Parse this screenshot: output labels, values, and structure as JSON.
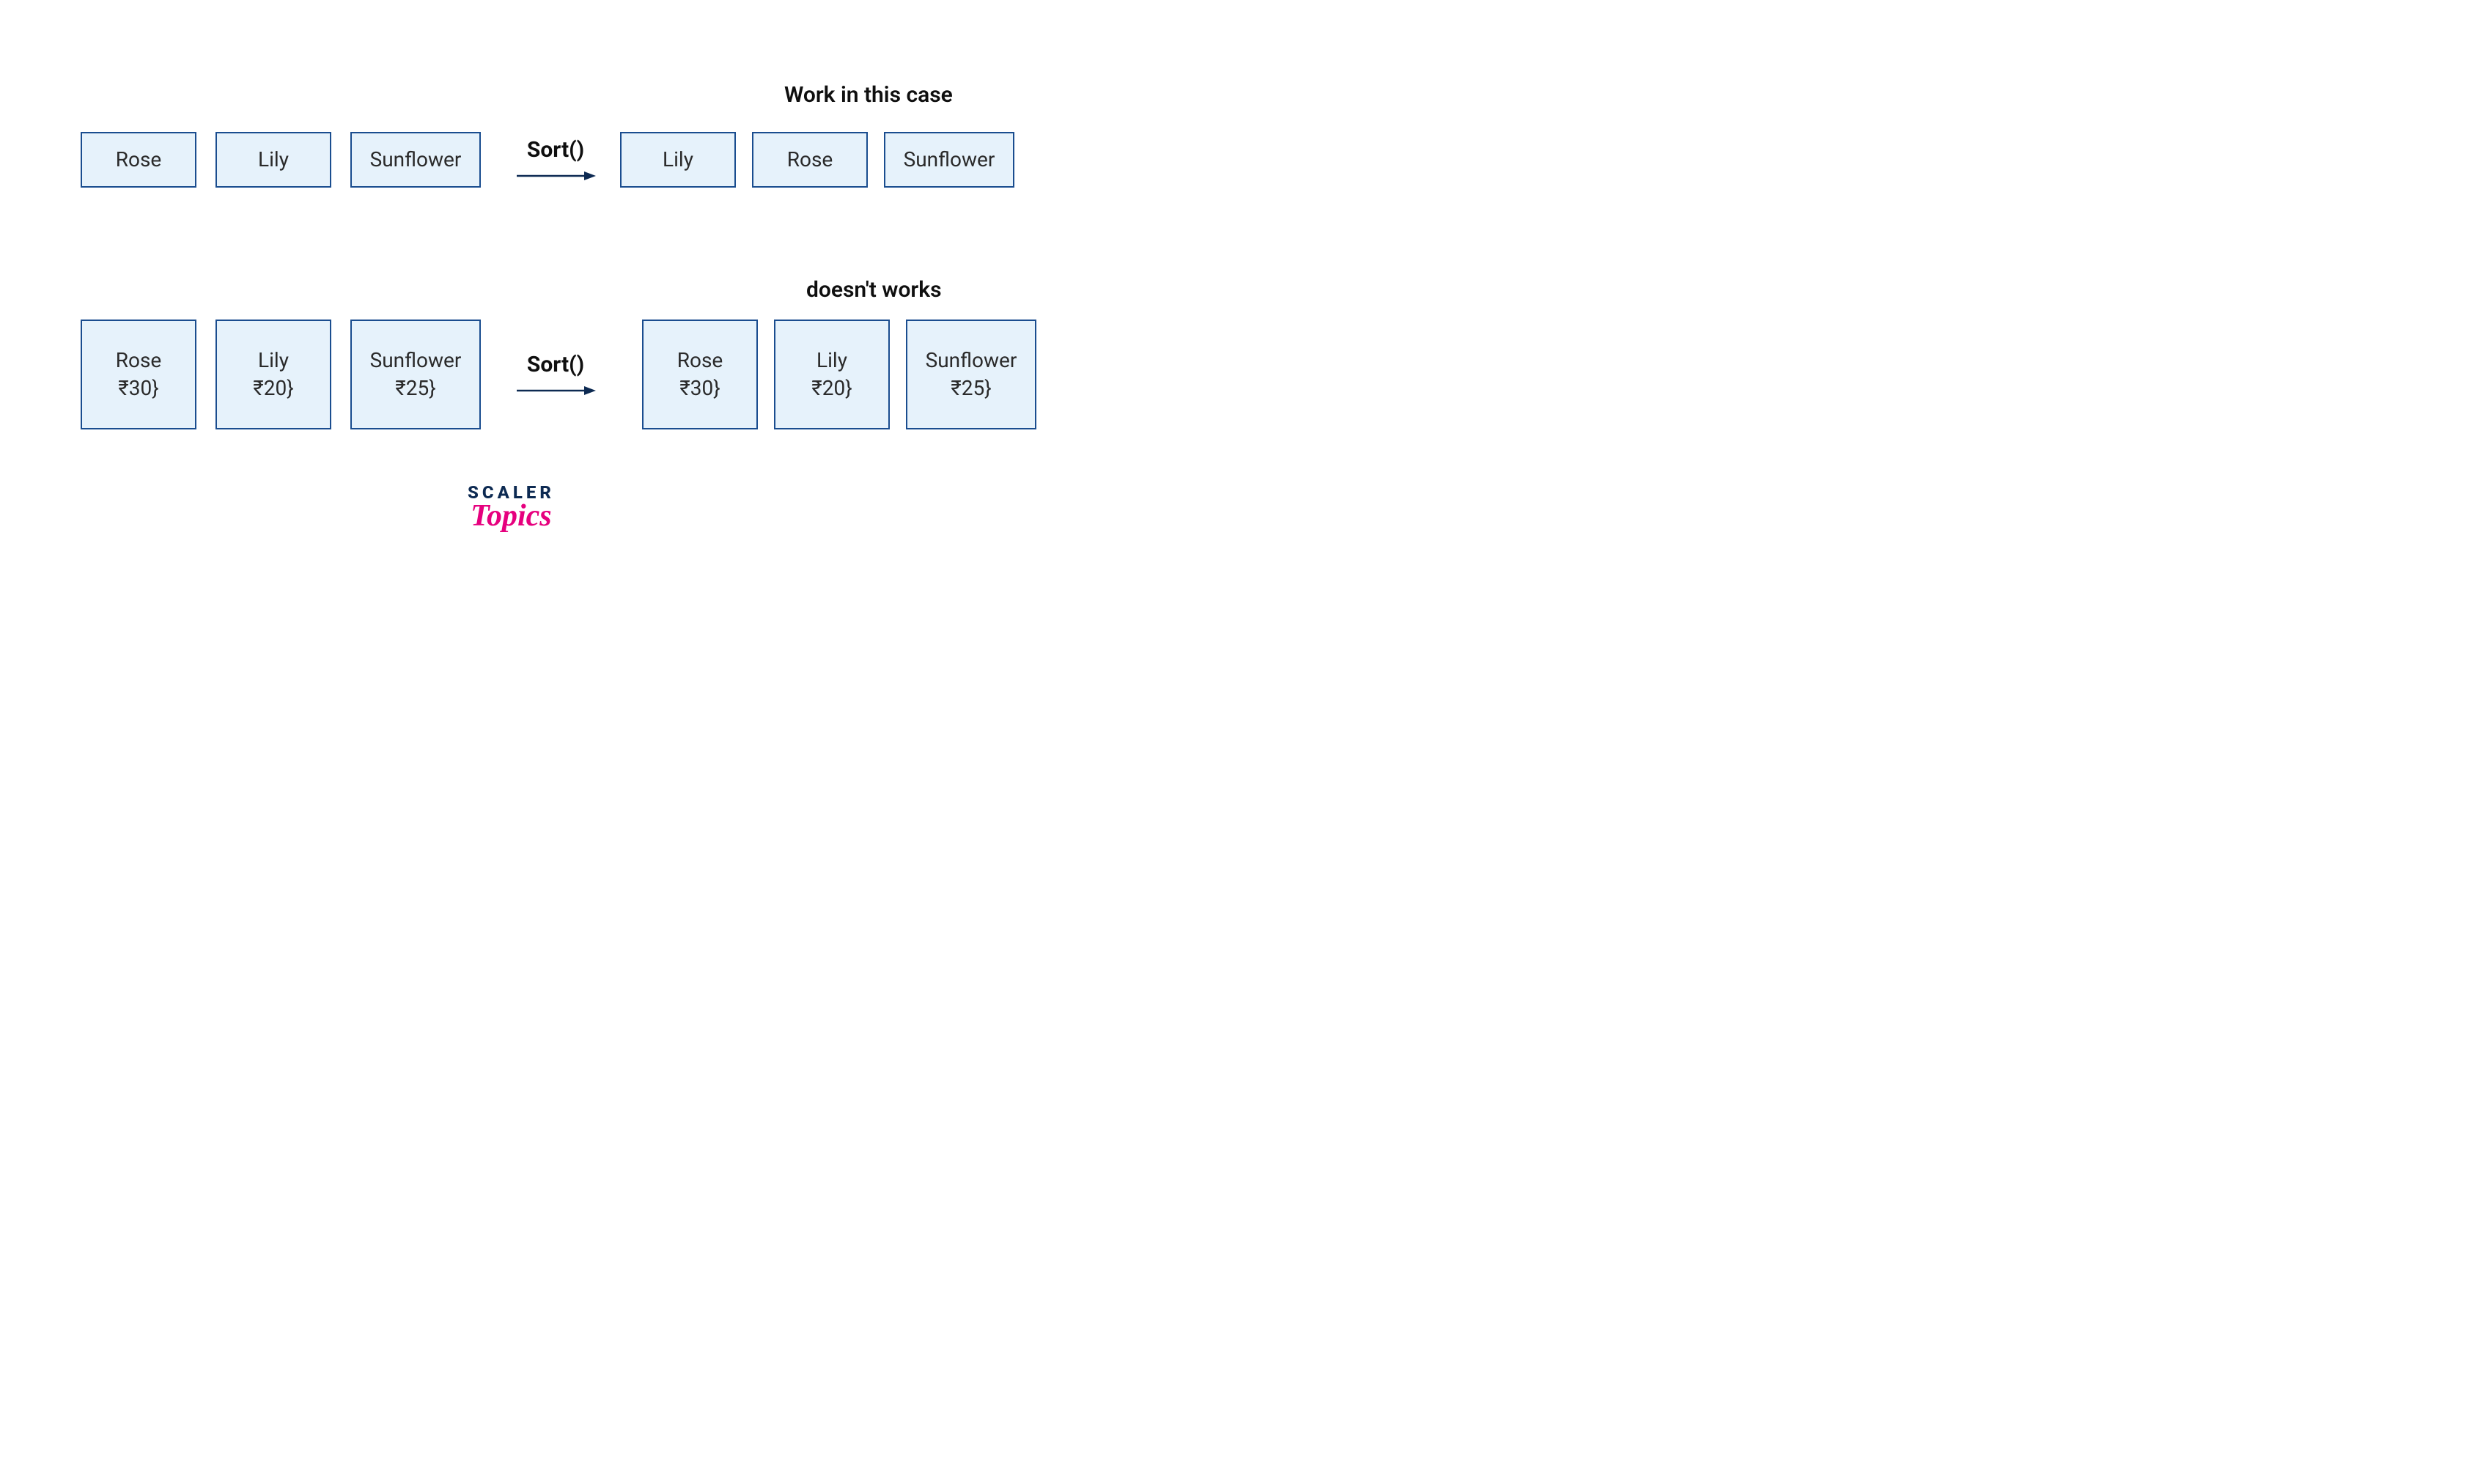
{
  "captions": {
    "works": "Work in this case",
    "not_works": "doesn't works"
  },
  "sort_label": "Sort()",
  "row1": {
    "input": [
      "Rose",
      "Lily",
      "Sunflower"
    ],
    "output": [
      "Lily",
      "Rose",
      "Sunflower"
    ]
  },
  "row2": {
    "input": [
      {
        "name": "Rose",
        "price": "₹30}"
      },
      {
        "name": "Lily",
        "price": "₹20}"
      },
      {
        "name": "Sunflower",
        "price": "₹25}"
      }
    ],
    "output": [
      {
        "name": "Rose",
        "price": "₹30}"
      },
      {
        "name": "Lily",
        "price": "₹20}"
      },
      {
        "name": "Sunflower",
        "price": "₹25}"
      }
    ]
  },
  "logo": {
    "top": "SCALER",
    "bottom": "Topics"
  },
  "colors": {
    "box_border": "#1a4d8f",
    "box_fill": "#e6f2fb",
    "arrow": "#0d2a52",
    "topics": "#e6007e"
  }
}
